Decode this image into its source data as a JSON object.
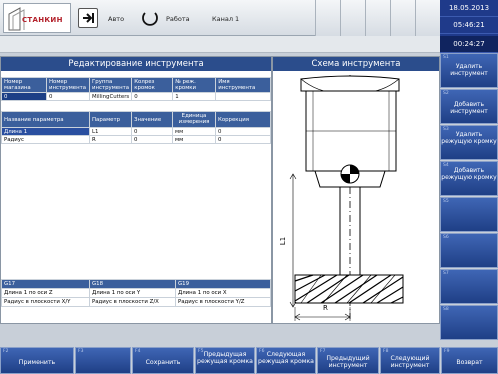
{
  "header": {
    "logo_text": "СТАНКИН",
    "mode_label": "Авто",
    "state_label": "Работа",
    "channel_label": "Канал 1"
  },
  "datetime": {
    "date": "18.05.2013",
    "time": "05:46:21",
    "timer": "00:24:27"
  },
  "left_panel": {
    "title": "Редактирование инструмента",
    "tool_headers": [
      "Номер магазина",
      "Номер инструмента",
      "Группа инструмента",
      "Колрез кромок",
      "№ реж. кромки",
      "Имя инструмента"
    ],
    "tool_row": [
      "0",
      "0",
      "MillingCutters",
      "0",
      "1",
      ""
    ],
    "param_headers": [
      "Название параметра",
      "Параметр",
      "Значение",
      "Единица измерения",
      "Коррекция"
    ],
    "param_rows": [
      [
        "Длина 1",
        "L1",
        "0",
        "мм",
        "0"
      ],
      [
        "Радиус",
        "R",
        "0",
        "мм",
        "0"
      ]
    ],
    "gcode_headers": [
      "G17",
      "G18",
      "G19"
    ],
    "gcode_rows": [
      [
        "Длина 1 по оси Z",
        "Длина 1 по оси Y",
        "Длина 1 по оси X"
      ],
      [
        "Радиус в плоскости X/Y",
        "Радиус в плоскости Z/X",
        "Радиус в плоскости Y/Z"
      ]
    ]
  },
  "right_panel": {
    "title": "Схема инструмента",
    "label_length": "L1",
    "label_radius": "R"
  },
  "vertical_softkeys": [
    {
      "num": "S1",
      "label": "Удалить инструмент"
    },
    {
      "num": "S2",
      "label": "Добавить инструмент"
    },
    {
      "num": "S3",
      "label": "Удалить режущую кромку"
    },
    {
      "num": "S4",
      "label": "Добавить режущую кромку"
    },
    {
      "num": "S5",
      "label": ""
    },
    {
      "num": "S6",
      "label": ""
    },
    {
      "num": "S7",
      "label": ""
    },
    {
      "num": "S8",
      "label": ""
    }
  ],
  "horizontal_softkeys": [
    {
      "num": "F2",
      "label": "Применить"
    },
    {
      "num": "F3",
      "label": ""
    },
    {
      "num": "F4",
      "label": "Сохранить"
    },
    {
      "num": "F5",
      "label": "Предыдущая режущая кромка"
    },
    {
      "num": "F6",
      "label": "Следующая режущая кромка"
    },
    {
      "num": "F7",
      "label": "Предыдущий инструмент"
    },
    {
      "num": "F8",
      "label": "Следующий инструмент"
    },
    {
      "num": "F9",
      "label": "Возврат"
    }
  ],
  "colors": {
    "accent": "#1f3a8a",
    "softkey": "#2a4fa0",
    "header": "#2b4d8c"
  }
}
